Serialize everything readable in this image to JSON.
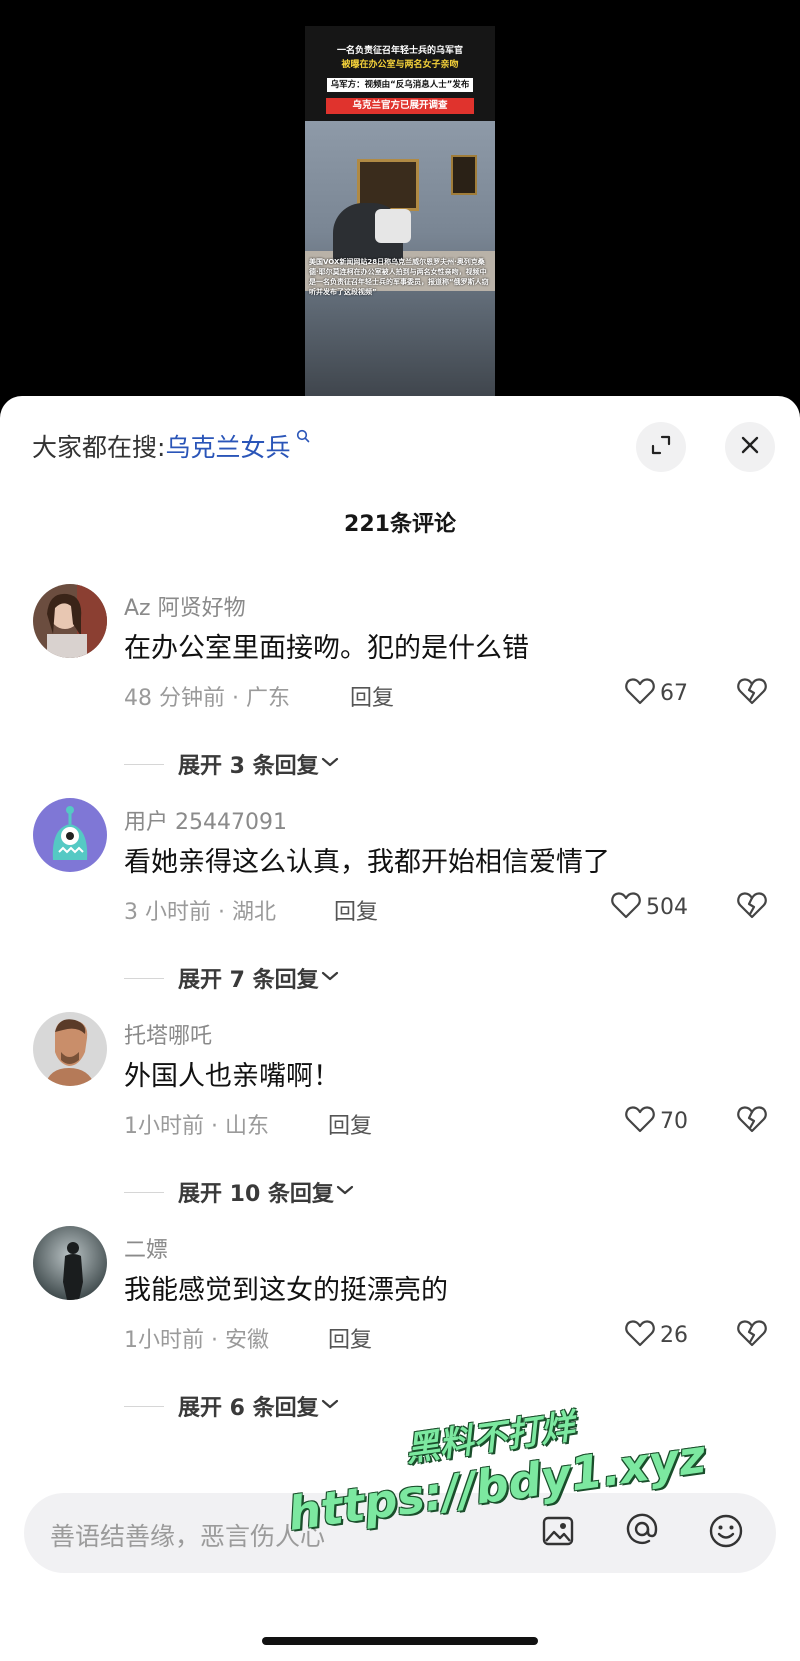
{
  "video": {
    "line1": "一名负责征召年轻士兵的乌军官",
    "line2": "被曝在办公室与两名女子亲吻",
    "line3": "乌军方：视频由“反乌消息人士”发布",
    "line4": "乌克兰官方已展开调查",
    "subtitle": "美国VOX新闻网站28日称乌克兰威尔恩罗夫州·奥列克桑德·耶尔莫连柯在办公室被人拍到与两名女性亲吻，视频中是一名负责征召年轻士兵的军事委员，报道称“俄罗斯人窃听并发布了这段视频”"
  },
  "sheet": {
    "search_prefix": "大家都在搜:",
    "search_keyword": "乌克兰女兵",
    "comment_count": "221条评论"
  },
  "comments": [
    {
      "user": "Az 阿贤好物",
      "text": "在办公室里面接吻。犯的是什么错",
      "meta": "48 分钟前 · 广东",
      "reply": "回复",
      "likes": "67",
      "expand": "展开 3 条回复"
    },
    {
      "user": "用户 25447091",
      "text": "看她亲得这么认真，我都开始相信爱情了",
      "meta": "3 小时前 · 湖北",
      "reply": "回复",
      "likes": "504",
      "expand": "展开 7 条回复"
    },
    {
      "user": "托塔哪吒",
      "text": "外国人也亲嘴啊！",
      "meta": "1小时前 · 山东",
      "reply": "回复",
      "likes": "70",
      "expand": "展开 10 条回复"
    },
    {
      "user": "二嫖",
      "text": "我能感觉到这女的挺漂亮的",
      "meta": "1小时前 · 安徽",
      "reply": "回复",
      "likes": "26",
      "expand": "展开 6 条回复"
    }
  ],
  "input": {
    "placeholder": "善语结善缘，恶言伤人心"
  },
  "watermark": {
    "line1": "黑料不打烊",
    "line2": "https://bdy1.xyz"
  },
  "icons": {
    "search": "search-icon",
    "expand": "expand-icon",
    "close": "close-icon",
    "like": "heart-icon",
    "dislike": "broken-heart-icon",
    "image": "image-icon",
    "at": "at-icon",
    "emoji": "emoji-icon"
  },
  "colors": {
    "search_keyword": "#2a55b8",
    "sheet_bg": "#ffffff",
    "watermark": "#7ce8a0"
  }
}
